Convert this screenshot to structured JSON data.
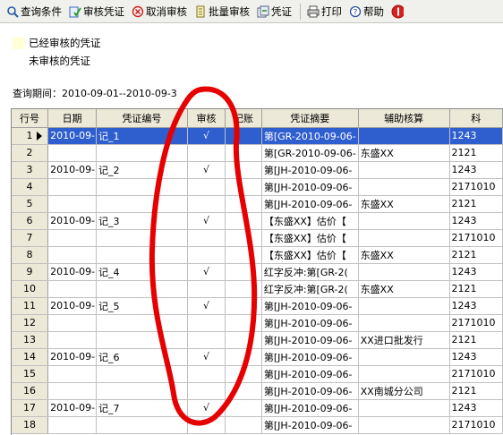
{
  "toolbar": {
    "items": [
      {
        "label": "查询条件",
        "icon": "search-icon"
      },
      {
        "label": "审核凭证",
        "icon": "audit-icon"
      },
      {
        "label": "取消审核",
        "icon": "cancel-icon"
      },
      {
        "label": "批量审核",
        "icon": "batch-icon"
      },
      {
        "label": "凭证",
        "icon": "voucher-icon"
      },
      {
        "label": "打印",
        "icon": "print-icon"
      },
      {
        "label": "帮助",
        "icon": "help-icon"
      },
      {
        "label": "",
        "icon": "exit-icon"
      }
    ]
  },
  "legend": {
    "audited_label": "已经审核的凭证",
    "unaudited_label": "未审核的凭证",
    "audited_color": "#ffffd8",
    "unaudited_color": "#ffffff"
  },
  "period_label": "查询期间：2010-09-01--2010-09-3",
  "colors": {
    "selected": "#2f5fcf",
    "annotation": "#e60000"
  },
  "table": {
    "headers": [
      "行号",
      "日期",
      "凭证编号",
      "审核",
      "记账",
      "凭证摘要",
      "辅助核算",
      "科"
    ],
    "rows": [
      [
        "1",
        "2010-09-",
        "记_1",
        "√",
        "",
        "第[GR-2010-09-06-",
        "",
        "1243"
      ],
      [
        "2",
        "",
        "",
        "",
        "",
        "第[GR-2010-09-06-",
        "东盛XX",
        "2121"
      ],
      [
        "3",
        "2010-09-",
        "记_2",
        "√",
        "",
        "第[JH-2010-09-06-",
        "",
        "1243"
      ],
      [
        "4",
        "",
        "",
        "",
        "",
        "第[JH-2010-09-06-",
        "",
        "2171010"
      ],
      [
        "5",
        "",
        "",
        "",
        "",
        "第[JH-2010-09-06-",
        "东盛XX",
        "2121"
      ],
      [
        "6",
        "2010-09-",
        "记_3",
        "√",
        "",
        "【东盛XX】估价【",
        "",
        "1243"
      ],
      [
        "7",
        "",
        "",
        "",
        "",
        "【东盛XX】估价【",
        "",
        "2171010"
      ],
      [
        "8",
        "",
        "",
        "",
        "",
        "【东盛XX】估价【",
        "东盛XX",
        "2121"
      ],
      [
        "9",
        "2010-09-",
        "记_4",
        "√",
        "",
        "红字反冲:第[GR-2(",
        "",
        "1243"
      ],
      [
        "10",
        "",
        "",
        "",
        "",
        "红字反冲:第[GR-2(",
        "东盛XX",
        "2121"
      ],
      [
        "11",
        "2010-09-",
        "记_5",
        "√",
        "",
        "第[JH-2010-09-06-",
        "",
        "1243"
      ],
      [
        "12",
        "",
        "",
        "",
        "",
        "第[JH-2010-09-06-",
        "",
        "2171010"
      ],
      [
        "13",
        "",
        "",
        "",
        "",
        "第[JH-2010-09-06-",
        "XX进口批发行",
        "2121"
      ],
      [
        "14",
        "2010-09-",
        "记_6",
        "√",
        "",
        "第[JH-2010-09-06-",
        "",
        "1243"
      ],
      [
        "15",
        "",
        "",
        "",
        "",
        "第[JH-2010-09-06-",
        "",
        "2171010"
      ],
      [
        "16",
        "",
        "",
        "",
        "",
        "第[JH-2010-09-06-",
        "XX南城分公司",
        "2121"
      ],
      [
        "17",
        "2010-09-",
        "记_7",
        "√",
        "",
        "第[JH-2010-09-06-",
        "",
        "1243"
      ],
      [
        "18",
        "",
        "",
        "",
        "",
        "第[JH-2010-09-06-",
        "",
        "2171010"
      ]
    ]
  }
}
